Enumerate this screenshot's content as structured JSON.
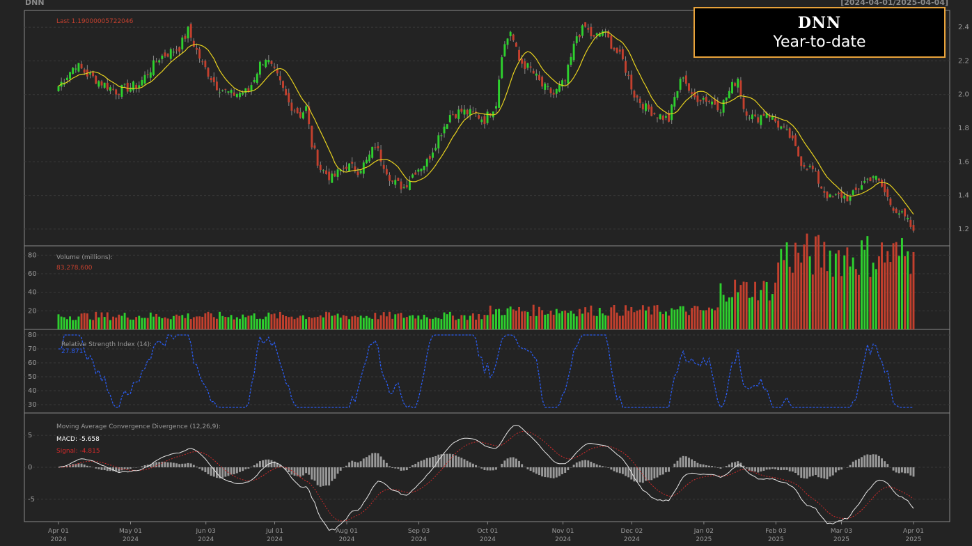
{
  "header": {
    "ticker": "DNN",
    "date_range": "[2024-04-01/2025-04-04]"
  },
  "title_box": {
    "line1": "DNN",
    "line2": "Year-to-date"
  },
  "colors": {
    "background": "#232323",
    "up": "#2ed12e",
    "down": "#c4402e",
    "ma": "#e8d21e",
    "rsi": "#2a5cf0",
    "macd": "#e8e8e8",
    "signal": "#d02a2a",
    "hist": "#9a9a9a",
    "border": "#e8a23a"
  },
  "chart_data": [
    {
      "type": "candlestick",
      "panel": "price",
      "last_label": "Last 1.19000005722046",
      "y_ticks": [
        "1.2",
        "1.4",
        "1.6",
        "1.8",
        "2.0",
        "2.2",
        "2.4"
      ],
      "ylim": [
        1.1,
        2.5
      ],
      "overlay": "moving average",
      "x_ticks": [
        "Apr 01\n2024",
        "May 01\n2024",
        "Jun 03\n2024",
        "Jul 01\n2024",
        "Aug 01\n2024",
        "Sep 03\n2024",
        "Oct 01\n2024",
        "Nov 01\n2024",
        "Dec 02\n2024",
        "Jan 02\n2025",
        "Feb 03\n2025",
        "Mar 03\n2025",
        "Apr 01\n2025"
      ],
      "close_keypoints": [
        [
          0,
          2.05
        ],
        [
          6,
          2.18
        ],
        [
          10,
          2.12
        ],
        [
          20,
          2.02
        ],
        [
          28,
          2.06
        ],
        [
          35,
          2.22
        ],
        [
          42,
          2.28
        ],
        [
          45,
          2.38
        ],
        [
          50,
          2.18
        ],
        [
          55,
          2.05
        ],
        [
          60,
          2.0
        ],
        [
          66,
          2.02
        ],
        [
          70,
          2.18
        ],
        [
          72,
          2.22
        ],
        [
          76,
          2.1
        ],
        [
          80,
          1.95
        ],
        [
          84,
          1.88
        ],
        [
          86,
          1.92
        ],
        [
          88,
          1.7
        ],
        [
          91,
          1.56
        ],
        [
          95,
          1.5
        ],
        [
          100,
          1.58
        ],
        [
          104,
          1.55
        ],
        [
          107,
          1.6
        ],
        [
          110,
          1.7
        ],
        [
          112,
          1.62
        ],
        [
          116,
          1.48
        ],
        [
          120,
          1.45
        ],
        [
          124,
          1.55
        ],
        [
          128,
          1.6
        ],
        [
          132,
          1.75
        ],
        [
          136,
          1.88
        ],
        [
          140,
          1.9
        ],
        [
          145,
          1.88
        ],
        [
          148,
          1.85
        ],
        [
          152,
          1.95
        ],
        [
          154,
          2.25
        ],
        [
          157,
          2.38
        ],
        [
          160,
          2.2
        ],
        [
          164,
          2.15
        ],
        [
          168,
          2.05
        ],
        [
          172,
          2.0
        ],
        [
          176,
          2.08
        ],
        [
          180,
          2.35
        ],
        [
          183,
          2.4
        ],
        [
          186,
          2.33
        ],
        [
          189,
          2.38
        ],
        [
          192,
          2.3
        ],
        [
          196,
          2.2
        ],
        [
          200,
          2.0
        ],
        [
          204,
          1.92
        ],
        [
          208,
          1.88
        ],
        [
          212,
          1.85
        ],
        [
          214,
          1.98
        ],
        [
          217,
          2.12
        ],
        [
          220,
          1.98
        ],
        [
          224,
          1.98
        ],
        [
          228,
          1.95
        ],
        [
          230,
          1.92
        ],
        [
          234,
          2.05
        ],
        [
          236,
          2.1
        ],
        [
          238,
          1.92
        ],
        [
          242,
          1.85
        ],
        [
          246,
          1.9
        ],
        [
          250,
          1.82
        ],
        [
          254,
          1.75
        ],
        [
          258,
          1.6
        ],
        [
          262,
          1.55
        ],
        [
          265,
          1.45
        ],
        [
          268,
          1.38
        ],
        [
          272,
          1.4
        ],
        [
          275,
          1.38
        ],
        [
          279,
          1.47
        ],
        [
          283,
          1.52
        ],
        [
          286,
          1.45
        ],
        [
          289,
          1.35
        ],
        [
          292,
          1.3
        ],
        [
          295,
          1.24
        ],
        [
          297,
          1.19
        ]
      ]
    },
    {
      "type": "bar",
      "panel": "volume",
      "label": "Volume (millions):",
      "last_label": "83,278,600",
      "y_ticks": [
        "20",
        "40",
        "60",
        "80"
      ],
      "ylim": [
        0,
        90
      ]
    },
    {
      "type": "line",
      "panel": "rsi",
      "label": "Relative Strength Index (14):",
      "last_label": "27.871",
      "y_ticks": [
        "30",
        "40",
        "50",
        "60",
        "70",
        "80"
      ],
      "ylim": [
        24,
        84
      ]
    },
    {
      "type": "line",
      "panel": "macd",
      "label": "Moving Average Convergence Divergence (12,26,9):",
      "macd_label": "MACD: -5.658",
      "signal_label": "Signal: -4.815",
      "y_ticks": [
        "-5",
        "0",
        "5"
      ],
      "ylim": [
        -8.5,
        8.5
      ]
    }
  ]
}
